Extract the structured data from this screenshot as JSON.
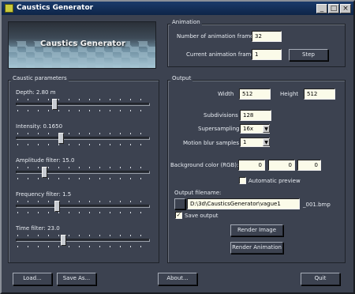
{
  "window": {
    "title": "Caustics Generator",
    "minimize": "_",
    "maximize": "□",
    "close": "×"
  },
  "banner": {
    "title": "Caustics Generator"
  },
  "animation": {
    "group_title": "Animation",
    "frames_label": "Number of animation frames",
    "frames_value": "32",
    "current_label": "Current animation frame",
    "current_value": "1",
    "step_label": "Step"
  },
  "caustic": {
    "group_title": "Caustic parameters",
    "sliders": [
      {
        "label": "Depth:  2.80 m",
        "position": 0.28
      },
      {
        "label": "Intensity:  0.1650",
        "position": 0.33
      },
      {
        "label": "Amplitude filter:  15.0",
        "position": 0.2
      },
      {
        "label": "Frequency filter:   1.5",
        "position": 0.3
      },
      {
        "label": "Time filter:    23.0",
        "position": 0.35
      }
    ]
  },
  "output": {
    "group_title": "Output",
    "width_label": "Width",
    "width_value": "512",
    "height_label": "Height",
    "height_value": "512",
    "subdivisions_label": "Subdivisions",
    "subdivisions_value": "128",
    "supersampling_label": "Supersampling",
    "supersampling_value": "16x",
    "motion_blur_label": "Motion blur samples",
    "motion_blur_value": "1",
    "bg_label": "Background color (RGB):",
    "bg_r": "0",
    "bg_g": "0",
    "bg_b": "0",
    "auto_preview_label": "Automatic preview",
    "auto_preview_checked": false,
    "filename_label": "Output filename:",
    "filename_value": "D:\\3d\\CausticsGenerator\\vague1",
    "filename_suffix": "_001.bmp",
    "save_output_label": "Save output",
    "save_output_checked": true,
    "render_image_label": "Render Image",
    "render_animation_label": "Render Animation"
  },
  "footer": {
    "load_label": "Load...",
    "save_as_label": "Save As...",
    "about_label": "About...",
    "quit_label": "Quit"
  }
}
